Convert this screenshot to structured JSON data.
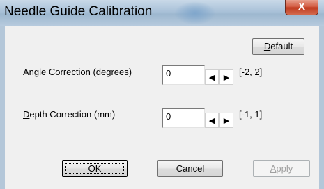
{
  "window": {
    "title": "Needle Guide Calibration",
    "close_glyph": "X"
  },
  "buttons": {
    "default": {
      "label": "Default",
      "mnemonic": "D",
      "rest": "efault"
    },
    "ok": "OK",
    "cancel": "Cancel",
    "apply": {
      "label": "Apply",
      "mnemonic": "A",
      "rest": "pply"
    }
  },
  "angle": {
    "label_pre": "A",
    "label_mnemonic": "n",
    "label_rest": "gle Correction (degrees)",
    "value": "0",
    "range": "[-2, 2]"
  },
  "depth": {
    "label_mnemonic": "D",
    "label_rest": "epth Correction (mm)",
    "value": "0",
    "range": "[-1, 1]"
  },
  "icons": {
    "decrement": "◀",
    "increment": "▶"
  }
}
